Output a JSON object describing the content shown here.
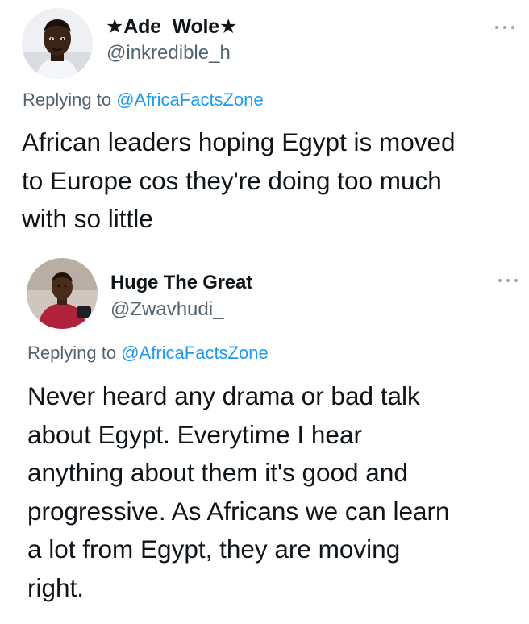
{
  "tweets": [
    {
      "display_name": "★Ade_Wole★",
      "handle": "@inkredible_h",
      "replying_prefix": "Replying to",
      "replying_to": "@AfricaFactsZone",
      "text": "African leaders hoping Egypt is moved\nto Europe cos they're doing too much\nwith so little",
      "more_icon": "ellipsis-icon"
    },
    {
      "display_name": "Huge The Great",
      "handle": "@Zwavhudi_",
      "replying_prefix": "Replying to",
      "replying_to": "@AfricaFactsZone",
      "text": "Never heard any drama or bad talk\nabout Egypt. Everytime I hear\nanything about them it's good and\nprogressive. As Africans we can learn\na lot from Egypt, they are moving\nright.",
      "more_icon": "ellipsis-icon"
    }
  ],
  "colors": {
    "text": "#0f1419",
    "secondary": "#536471",
    "link": "#1d9bf0"
  }
}
